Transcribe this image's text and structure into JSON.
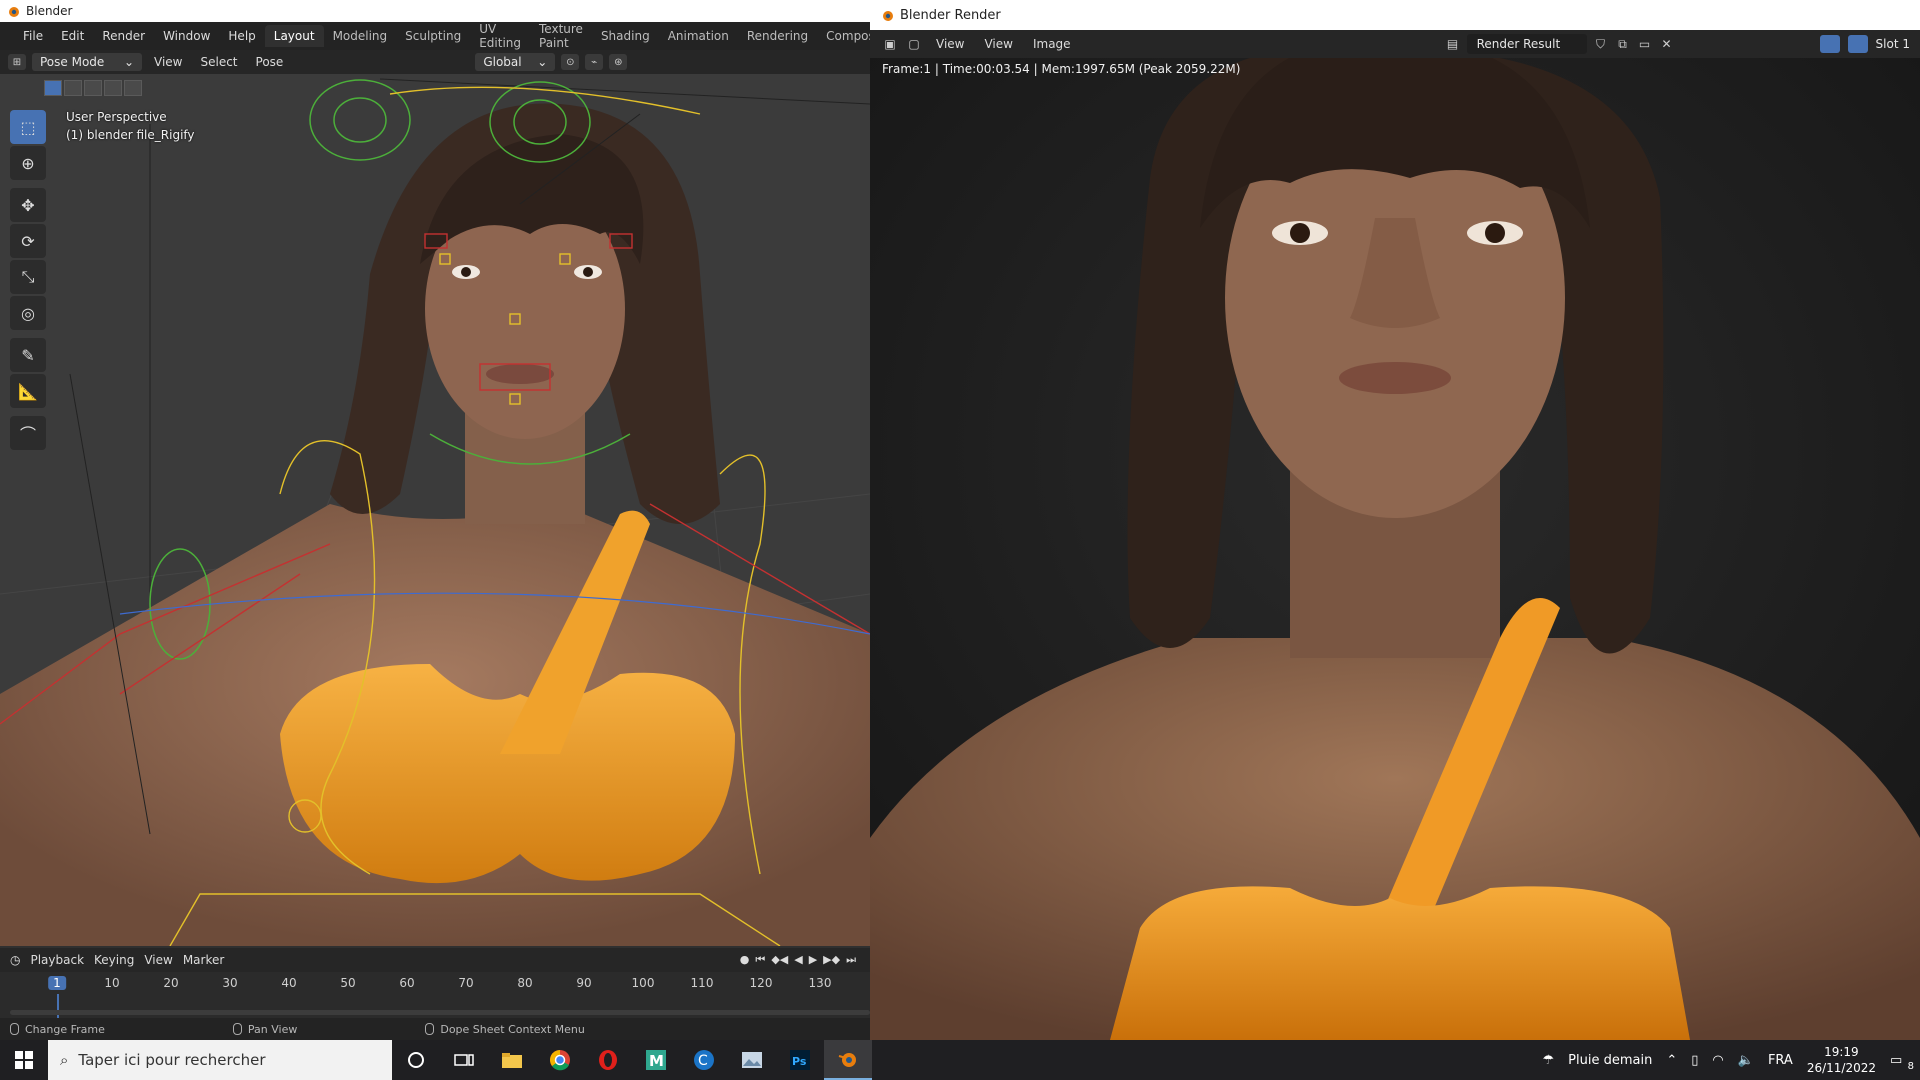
{
  "main_window": {
    "title": "Blender",
    "menus": [
      "File",
      "Edit",
      "Render",
      "Window",
      "Help"
    ],
    "workspaces": [
      "Layout",
      "Modeling",
      "Sculpting",
      "UV Editing",
      "Texture Paint",
      "Shading",
      "Animation",
      "Rendering",
      "Compositing"
    ],
    "active_workspace": "Layout"
  },
  "viewport_header": {
    "mode": "Pose Mode",
    "menus": [
      "View",
      "Select",
      "Pose"
    ],
    "orientation": "Global"
  },
  "viewport": {
    "perspective": "User Perspective",
    "object": "(1) blender file_Rigify"
  },
  "timeline": {
    "menus": [
      "Playback",
      "Keying",
      "View",
      "Marker"
    ],
    "current_frame": "1",
    "ticks": [
      "10",
      "20",
      "30",
      "40",
      "50",
      "60",
      "70",
      "80",
      "90",
      "100",
      "110",
      "120",
      "130"
    ]
  },
  "statusbar": {
    "hints": [
      "Change Frame",
      "Pan View",
      "Dope Sheet Context Menu"
    ]
  },
  "render_window": {
    "title": "Blender Render",
    "menus": [
      "View",
      "View",
      "Image"
    ],
    "image_name": "Render Result",
    "slot": "Slot 1",
    "info": "Frame:1 | Time:00:03.54 | Mem:1997.65M (Peak 2059.22M)"
  },
  "taskbar": {
    "search_placeholder": "Taper ici pour rechercher",
    "weather": "Pluie demain",
    "language": "FRA",
    "time": "19:19",
    "date": "26/11/2022",
    "notifications": "8"
  },
  "colors": {
    "accent": "#4772b3",
    "viewport_bg": "#3b3b3b",
    "top_orange": "#f2a22e",
    "skin": "#9a6e55",
    "hair": "#3a2a22"
  }
}
